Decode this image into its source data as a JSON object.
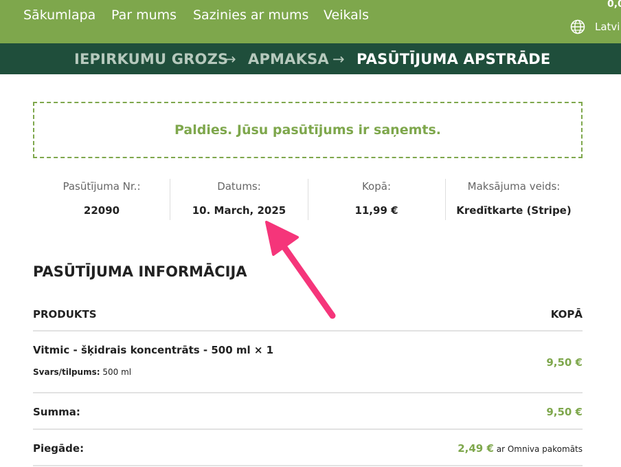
{
  "nav": {
    "items": [
      "Sākumlapa",
      "Par mums",
      "Sazinies ar mums",
      "Veikals"
    ],
    "cart_amount": "0,0",
    "language": "Latvi"
  },
  "steps": {
    "cart": "IEPIRKUMU GROZS",
    "payment": "APMAKSA",
    "processing": "PASŪTĪJUMA APSTRĀDE",
    "arrow": "→"
  },
  "notice": "Paldies. Jūsu pasūtījums ir saņemts.",
  "overview": {
    "order_label": "Pasūtījuma Nr.:",
    "order_value": "22090",
    "date_label": "Datums:",
    "date_value": "10. March, 2025",
    "total_label": "Kopā:",
    "total_value": "11,99 €",
    "method_label": "Maksājuma veids:",
    "method_value": "Kredītkarte (Stripe)"
  },
  "details": {
    "title": "PASŪTĪJUMA INFORMĀCIJA",
    "col_product": "PRODUKTS",
    "col_total": "KOPĀ",
    "item_name": "Vitmic - šķidrais koncentrāts - 500 ml",
    "item_qty": " × 1",
    "item_meta_label": "Svars/tilpums:",
    "item_meta_value": " 500 ml",
    "item_price": "9,50 €",
    "subtotal_label": "Summa:",
    "subtotal_value": "9,50 €",
    "shipping_label": "Piegāde:",
    "shipping_value": "2,49 €",
    "shipping_note": " ar Omniva pakomāts"
  },
  "colors": {
    "header_green": "#7ea74c",
    "steps_dark_green": "#1f4e3b",
    "accent_green": "#7ea74c",
    "annotation_pink": "#f5357a"
  }
}
